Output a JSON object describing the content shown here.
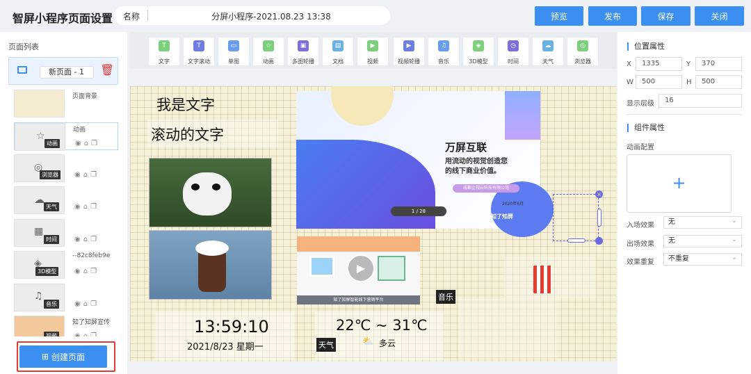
{
  "header": {
    "app_title": "智屏小程序页面设置",
    "name_label": "名称",
    "name_value": "分屏小程序-2021.08.23 13:38",
    "buttons": [
      {
        "label": "预览"
      },
      {
        "label": "发布"
      },
      {
        "label": "保存"
      },
      {
        "label": "关闭"
      }
    ]
  },
  "left": {
    "list_title": "页面列表",
    "current_page": "新页面 - 1",
    "items": [
      {
        "name": "页面背景",
        "tag": ""
      },
      {
        "name": "动画",
        "tag": "动画"
      },
      {
        "name": "",
        "tag": "浏览器"
      },
      {
        "name": "",
        "tag": "天气"
      },
      {
        "name": "",
        "tag": "时间"
      },
      {
        "name": "--82c8feb9e",
        "tag": "3D模型"
      },
      {
        "name": "",
        "tag": "音乐"
      },
      {
        "name": "知了知屏宣传",
        "tag": "视频"
      }
    ],
    "create_label": "创建页面"
  },
  "toolbar": {
    "tools": [
      {
        "label": "文字",
        "color": "#7ccf7c",
        "icon": "T"
      },
      {
        "label": "文字滚动",
        "color": "#6f7de0",
        "icon": "T"
      },
      {
        "label": "单图",
        "color": "#6a9de8",
        "icon": "▭"
      },
      {
        "label": "动画",
        "color": "#7ccf7c",
        "icon": "☆"
      },
      {
        "label": "多图轮播",
        "color": "#7b6fd8",
        "icon": "▣"
      },
      {
        "label": "文档",
        "color": "#6ab0e0",
        "icon": "▤"
      },
      {
        "label": "视频",
        "color": "#7ccf7c",
        "icon": "▶"
      },
      {
        "label": "视频轮播",
        "color": "#6f7de0",
        "icon": "▶"
      },
      {
        "label": "音乐",
        "color": "#6a9de8",
        "icon": "♫"
      },
      {
        "label": "3D模型",
        "color": "#7ccf7c",
        "icon": "◈"
      },
      {
        "label": "时间",
        "color": "#7b6fd8",
        "icon": "◷"
      },
      {
        "label": "天气",
        "color": "#6ab0e0",
        "icon": "☁"
      },
      {
        "label": "浏览器",
        "color": "#7ccf7c",
        "icon": "◎"
      }
    ]
  },
  "canvas": {
    "text1": "我是文字",
    "text2": "滚动的文字",
    "banner": {
      "title": "万屏互联",
      "line1": "用流动的视觉创造您",
      "line2": "的线下商业价值。",
      "company": "成都企视云科技有限公司",
      "date": "2020年6月",
      "pager": "1 / 28",
      "brand": "知了知屏"
    },
    "video_caption": "知了知屏智能线下营销平台",
    "music_tag": "音乐",
    "time": "13:59:10",
    "date": "2021/8/23  星期一",
    "temp": "22℃ ~ 31℃",
    "weather": "多云",
    "weather_tag": "天气"
  },
  "right": {
    "position_title": "位置属性",
    "x_label": "X",
    "x": "1335",
    "y_label": "Y",
    "y": "370",
    "w_label": "W",
    "w": "500",
    "h_label": "H",
    "h": "500",
    "layer_label": "显示层级",
    "layer": "16",
    "component_title": "组件属性",
    "anim_config": "动画配置",
    "enter_label": "入场效果",
    "enter": "无",
    "exit_label": "出场效果",
    "exit": "无",
    "repeat_label": "效果重复",
    "repeat": "不重复"
  }
}
